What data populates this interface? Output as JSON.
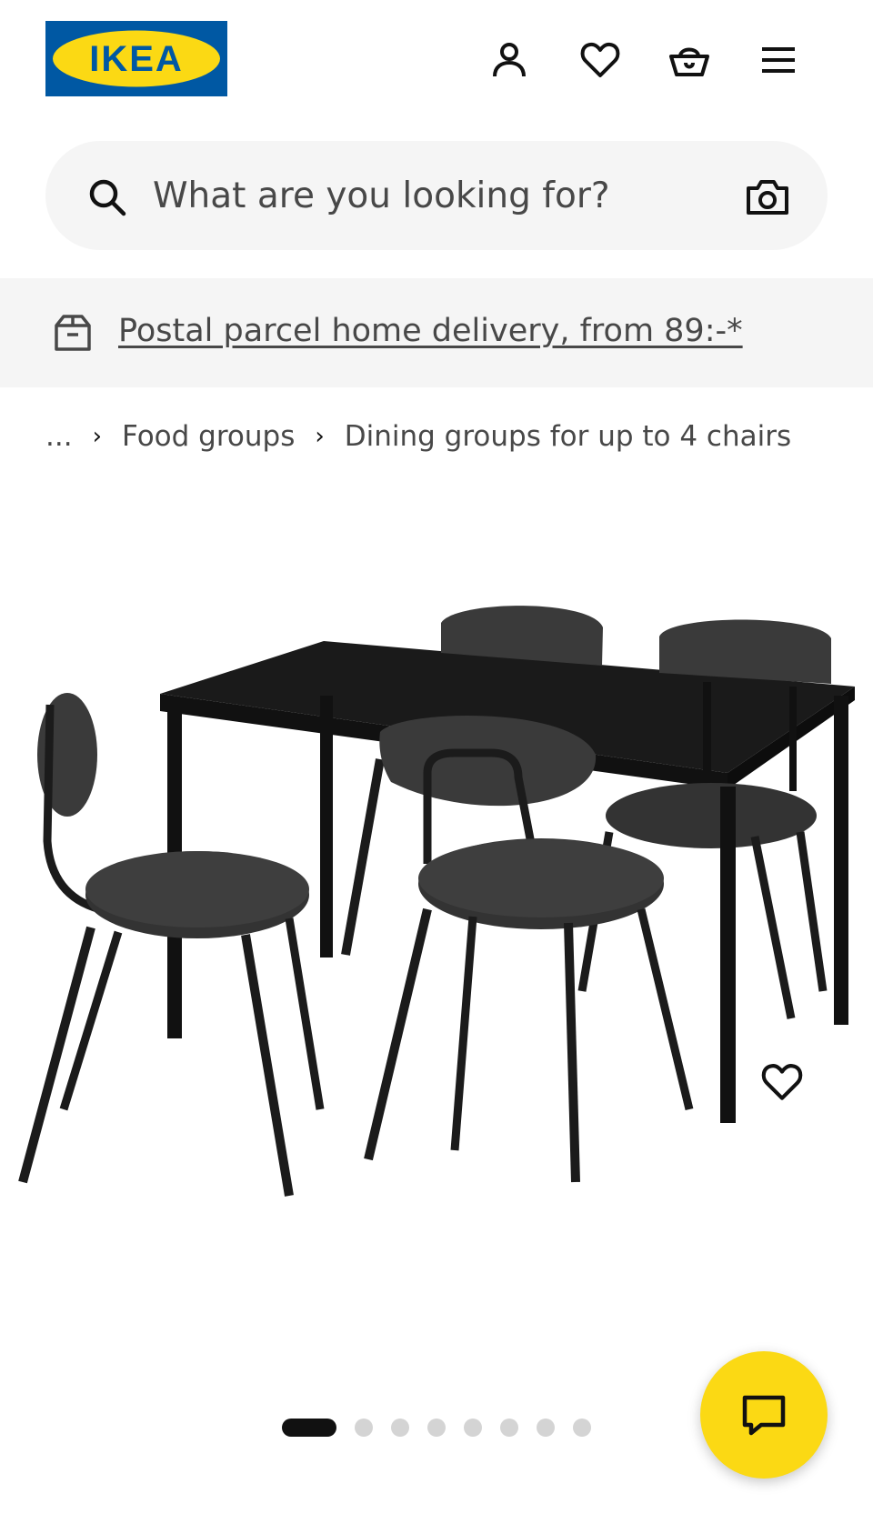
{
  "brand": {
    "logo_text": "IKEA",
    "blue": "#0058a3",
    "yellow": "#fbd914"
  },
  "header": {
    "icons": [
      "person-icon",
      "heart-icon",
      "basket-icon",
      "menu-icon"
    ]
  },
  "search": {
    "placeholder": "What are you looking for?"
  },
  "banner": {
    "text": "Postal parcel home delivery, from 89:-*"
  },
  "breadcrumb": {
    "ellipsis": "...",
    "items": [
      "Food groups",
      "Dining groups for up to 4 chairs"
    ],
    "separator": "›"
  },
  "gallery": {
    "image_count": 8,
    "active_index": 0
  },
  "colors": {
    "surface": "#f5f5f5",
    "text_secondary": "#484848",
    "chat_button": "#fbd914"
  }
}
